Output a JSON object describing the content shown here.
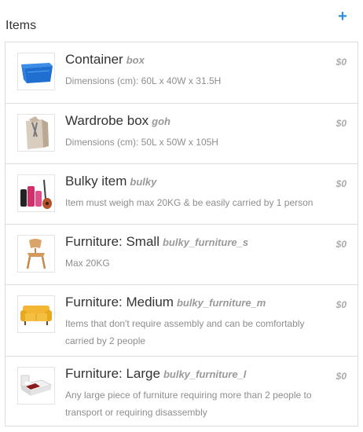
{
  "header": {
    "title": "Items",
    "add_icon": "plus-icon",
    "accent_color": "#2a8fe0"
  },
  "items": [
    {
      "title": "Container",
      "code": "box",
      "description": "Dimensions (cm): 60L x 40W x 31.5H",
      "price": "$0",
      "image": "blue-storage-container-image"
    },
    {
      "title": "Wardrobe box",
      "code": "goh",
      "description": "Dimensions (cm): 50L x 50W x 105H",
      "price": "$0",
      "image": "wardrobe-box-image"
    },
    {
      "title": "Bulky item",
      "code": "bulky",
      "description": "Item must weigh max 20KG & be easily carried by 1 person",
      "price": "$0",
      "image": "luggage-golf-guitar-image"
    },
    {
      "title": "Furniture: Small",
      "code": "bulky_furniture_s",
      "description": "Max 20KG",
      "price": "$0",
      "image": "wooden-chair-image"
    },
    {
      "title": "Furniture: Medium",
      "code": "bulky_furniture_m",
      "description": "Items that don't require assembly and can be comfortably carried by 2 people",
      "price": "$0",
      "image": "yellow-sofa-image"
    },
    {
      "title": "Furniture: Large",
      "code": "bulky_furniture_l",
      "description": "Any large piece of furniture requiring more than 2 people to transport or requiring disassembly",
      "price": "$0",
      "image": "white-bed-image"
    }
  ]
}
